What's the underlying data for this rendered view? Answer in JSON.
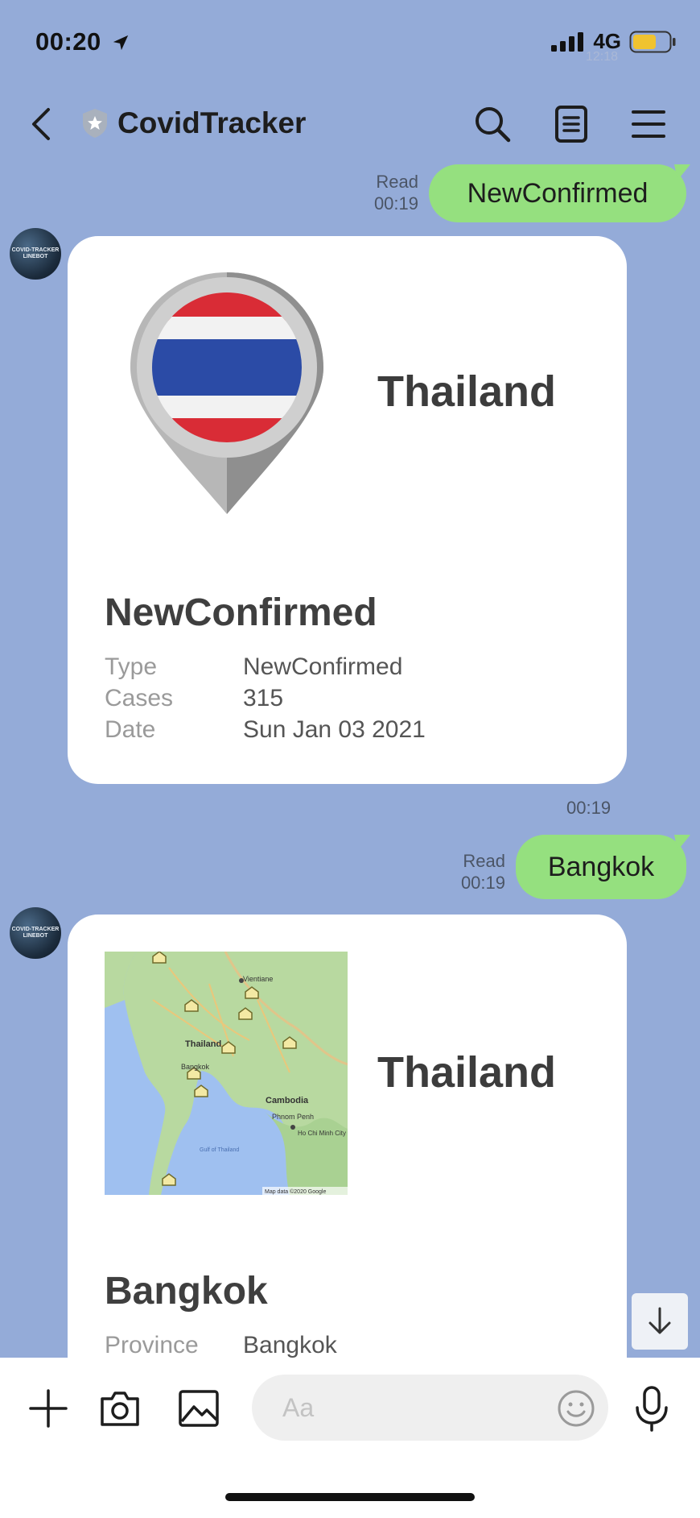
{
  "status": {
    "time": "00:20",
    "network": "4G",
    "ghost_time": "12:18"
  },
  "header": {
    "title": "CovidTracker"
  },
  "avatar_text": "COVID-TRACKER LINEBOT",
  "chat": {
    "msg1": {
      "read": "Read",
      "time": "00:19",
      "text": "NewConfirmed"
    },
    "card1": {
      "country": "Thailand",
      "heading": "NewConfirmed",
      "rows": [
        {
          "label": "Type",
          "value": "NewConfirmed"
        },
        {
          "label": "Cases",
          "value": "315"
        },
        {
          "label": "Date",
          "value": "Sun Jan 03 2021"
        }
      ],
      "time": "00:19"
    },
    "msg2": {
      "read": "Read",
      "time": "00:19",
      "text": "Bangkok"
    },
    "card2": {
      "country": "Thailand",
      "heading": "Bangkok",
      "rows": [
        {
          "label": "Province",
          "value": "Bangkok"
        }
      ],
      "map_labels": {
        "vientiane": "Vientiane",
        "thailand": "Thailand",
        "bangkok": "Bangkok",
        "cambodia": "Cambodia",
        "phnom_penh": "Phnom Penh",
        "ho_chi_minh": "Ho Chi Minh City",
        "gulf": "Gulf of Thailand",
        "attribution": "Map data ©2020 Google"
      }
    }
  },
  "input": {
    "placeholder": "Aa"
  },
  "colors": {
    "background": "#94abd8",
    "bubble_out": "#95e07f",
    "card": "#ffffff"
  }
}
